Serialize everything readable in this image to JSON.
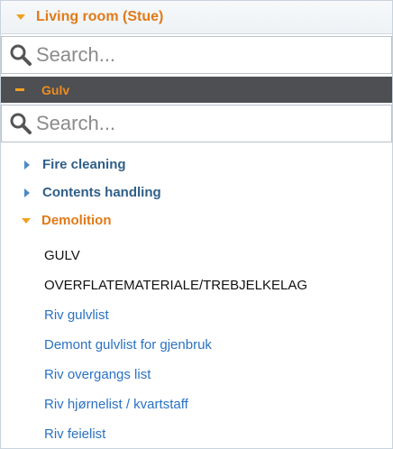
{
  "room": {
    "title": "Living room (Stue)"
  },
  "search_top": {
    "placeholder": "Search..."
  },
  "category": {
    "label": "Gulv"
  },
  "search_inner": {
    "placeholder": "Search..."
  },
  "tree": {
    "items": [
      {
        "label": "Fire cleaning",
        "state": "collapsed"
      },
      {
        "label": "Contents handling",
        "state": "collapsed"
      },
      {
        "label": "Demolition",
        "state": "expanded"
      }
    ]
  },
  "leaves": [
    {
      "label": "GULV",
      "kind": "header"
    },
    {
      "label": "OVERFLATEMATERIALE/TREBJELKELAG",
      "kind": "header"
    },
    {
      "label": "Riv gulvlist",
      "kind": "link"
    },
    {
      "label": "Demont gulvlist for gjenbruk",
      "kind": "link"
    },
    {
      "label": "Riv overgangs list",
      "kind": "link"
    },
    {
      "label": "Riv hjørnelist / kvartstaff",
      "kind": "link"
    },
    {
      "label": "Riv feielist",
      "kind": "link"
    }
  ],
  "colors": {
    "accent_orange": "#e07a18",
    "caret_orange": "#f0a020",
    "category_bar": "#4d4f52",
    "tree_label": "#2f5f88",
    "link_blue": "#2b72c2"
  },
  "icons": {
    "room_toggle": "caret-down-icon",
    "search": "search-icon",
    "category_toggle": "minus-icon",
    "collapsed": "caret-right-icon",
    "expanded": "caret-down-icon"
  }
}
